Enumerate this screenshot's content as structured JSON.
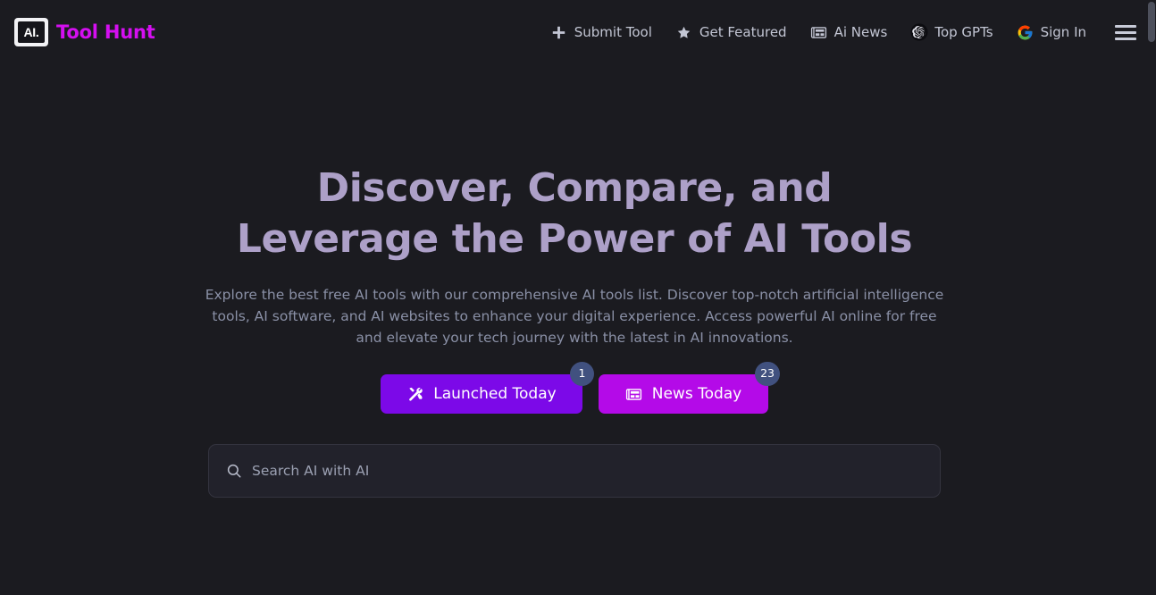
{
  "colors": {
    "page_bg": "#1b1b20",
    "brand_accent": "#d40ff0",
    "heading": "#ada0c8",
    "body_text": "#8a90a6",
    "launched_button": "#7c09e8",
    "news_button": "#b40ae8",
    "badge": "#41517f",
    "search_bg": "#22222b",
    "search_border": "#34343f",
    "scrollbar_thumb": "#4d505c"
  },
  "header": {
    "logo_text": "AI.",
    "logo_icon": "ai-logo-icon",
    "brand_name": "Tool Hunt",
    "nav": [
      {
        "label": "Submit Tool",
        "icon": "plus-icon"
      },
      {
        "label": "Get Featured",
        "icon": "star-icon"
      },
      {
        "label": "Ai News",
        "icon": "newspaper-icon"
      },
      {
        "label": "Top GPTs",
        "icon": "openai-icon"
      },
      {
        "label": "Sign In",
        "icon": "google-icon"
      }
    ],
    "menu_icon": "hamburger-menu-icon"
  },
  "hero": {
    "title": "Discover, Compare, and Leverage the Power of AI Tools",
    "subtitle": "Explore the best free AI tools with our comprehensive AI tools list. Discover top-notch artificial intelligence tools, AI software, and AI websites to enhance your digital experience. Access powerful AI online for free and elevate your tech journey with the latest in AI innovations.",
    "buttons": [
      {
        "label": "Launched Today",
        "icon": "tools-icon",
        "badge": "1"
      },
      {
        "label": "News Today",
        "icon": "newspaper-icon",
        "badge": "23"
      }
    ]
  },
  "search": {
    "placeholder": "Search AI with AI",
    "value": "",
    "icon": "search-icon"
  }
}
